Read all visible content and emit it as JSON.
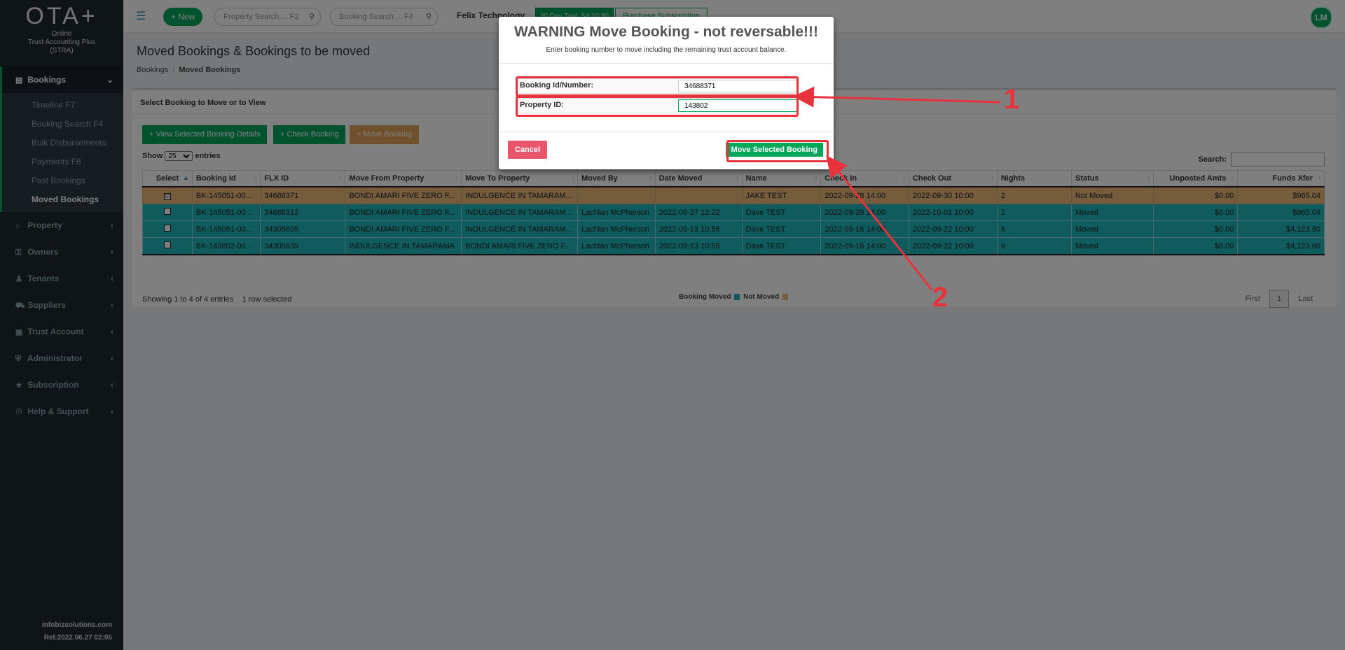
{
  "sidebar": {
    "brand": "OTA+",
    "subtitle_1": "Online",
    "subtitle_2": "Trust Accounting Plus",
    "subtitle_3": "(STRA)",
    "bookings_label": "Bookings",
    "sub_items": [
      "Timeline F7",
      "Booking Search F4",
      "Bulk Disbursements",
      "Payments F8",
      "Past Bookings",
      "Moved Bookings"
    ],
    "items": [
      "Property",
      "Owners",
      "Tenants",
      "Suppliers",
      "Trust Account",
      "Administrator",
      "Subscription",
      "Help & Support"
    ],
    "footer_site": "infobizsolutions.com",
    "footer_rel": "Rel:2022.06.27 02:05"
  },
  "header": {
    "new_label": "+ New",
    "property_search": "Property Search ... F2",
    "booking_search": "Booking Search ... F4",
    "company": "Felix Technology",
    "trial": "30 Day Trial: 54:10:30",
    "purchase": "Purchase Subscription",
    "avatar": "LM"
  },
  "page": {
    "title": "Moved Bookings & Bookings to be moved",
    "crumb_1": "Bookings",
    "crumb_2": "Moved Bookings",
    "box_title": "Select Booking to Move or to View",
    "btn_view": "+ View Selected Booking Details",
    "btn_check": "+ Check Booking",
    "btn_move": "+ Move Booking",
    "show_label": "Show",
    "show_value": "25",
    "entries_label": "entries",
    "search_label": "Search:",
    "showing": "Showing 1 to 4 of 4 entries",
    "selected": "1 row selected",
    "pager_first": "First",
    "pager_page": "1",
    "pager_last": "Last",
    "legend_moved": "Booking Moved",
    "legend_notmoved": "Not Moved"
  },
  "table": {
    "columns": [
      "Select",
      "Booking Id",
      "FLX ID",
      "Move From Property",
      "Move To Property",
      "Moved By",
      "Date Moved",
      "Name",
      "Check In",
      "Check Out",
      "Nights",
      "Status",
      "Unposted Amts",
      "Funds Xfer"
    ],
    "rows": [
      {
        "check": "☑",
        "booking": "BK-145051-00...",
        "flx": "34688371",
        "from": "BONDI AMARI FIVE ZERO F...",
        "to": "INDULGENCE IN TAMARAM...",
        "by": "",
        "date": "",
        "name": "JAKE TEST",
        "in": "2022-09-28 14:00",
        "out": "2022-09-30 10:00",
        "nights": "2",
        "status": "Not Moved",
        "unposted": "$0.00",
        "funds": "$965.04"
      },
      {
        "check": "",
        "booking": "BK-145051-00...",
        "flx": "34688312",
        "from": "BONDI AMARI FIVE ZERO F...",
        "to": "INDULGENCE IN TAMARAM...",
        "by": "Lachlan McPherson",
        "date": "2022-09-27 12:22",
        "name": "Dave TEST",
        "in": "2022-09-29 14:00",
        "out": "2022-10-01 10:00",
        "nights": "2",
        "status": "Moved",
        "unposted": "$0.00",
        "funds": "$965.04"
      },
      {
        "check": "",
        "booking": "BK-145051-00...",
        "flx": "34305635",
        "from": "BONDI AMARI FIVE ZERO F...",
        "to": "INDULGENCE IN TAMARAM...",
        "by": "Lachlan McPherson",
        "date": "2022-09-13 10:56",
        "name": "Dave TEST",
        "in": "2022-09-16 14:00",
        "out": "2022-09-22 10:00",
        "nights": "6",
        "status": "Moved",
        "unposted": "$0.00",
        "funds": "$4,123.80"
      },
      {
        "check": "",
        "booking": "BK-143802-00...",
        "flx": "34305635",
        "from": "INDULGENCE IN TAMARAMA",
        "to": "BONDI AMARI FIVE ZERO F...",
        "by": "Lachlan McPherson",
        "date": "2022-09-13 10:55",
        "name": "Dave TEST",
        "in": "2022-09-16 14:00",
        "out": "2022-09-22 10:00",
        "nights": "6",
        "status": "Moved",
        "unposted": "$0.00",
        "funds": "$4,123.80"
      }
    ]
  },
  "modal": {
    "title": "WARNING Move Booking - not reversable!!!",
    "subtitle": "Enter booking number to move including the remaining trust account balance.",
    "booking_label": "Booking Id/Number:",
    "booking_value": "34688371",
    "property_label": "Property ID:",
    "property_value": "143802",
    "cancel_label": "Cancel",
    "move_label": "Move Selected Booking"
  },
  "annotations": {
    "num1": "1",
    "num2": "2",
    "color": "#e8323c"
  },
  "colors": {
    "moved": "#1fb6ba",
    "not_moved": "#e8b97a",
    "accent": "#00a65a"
  }
}
